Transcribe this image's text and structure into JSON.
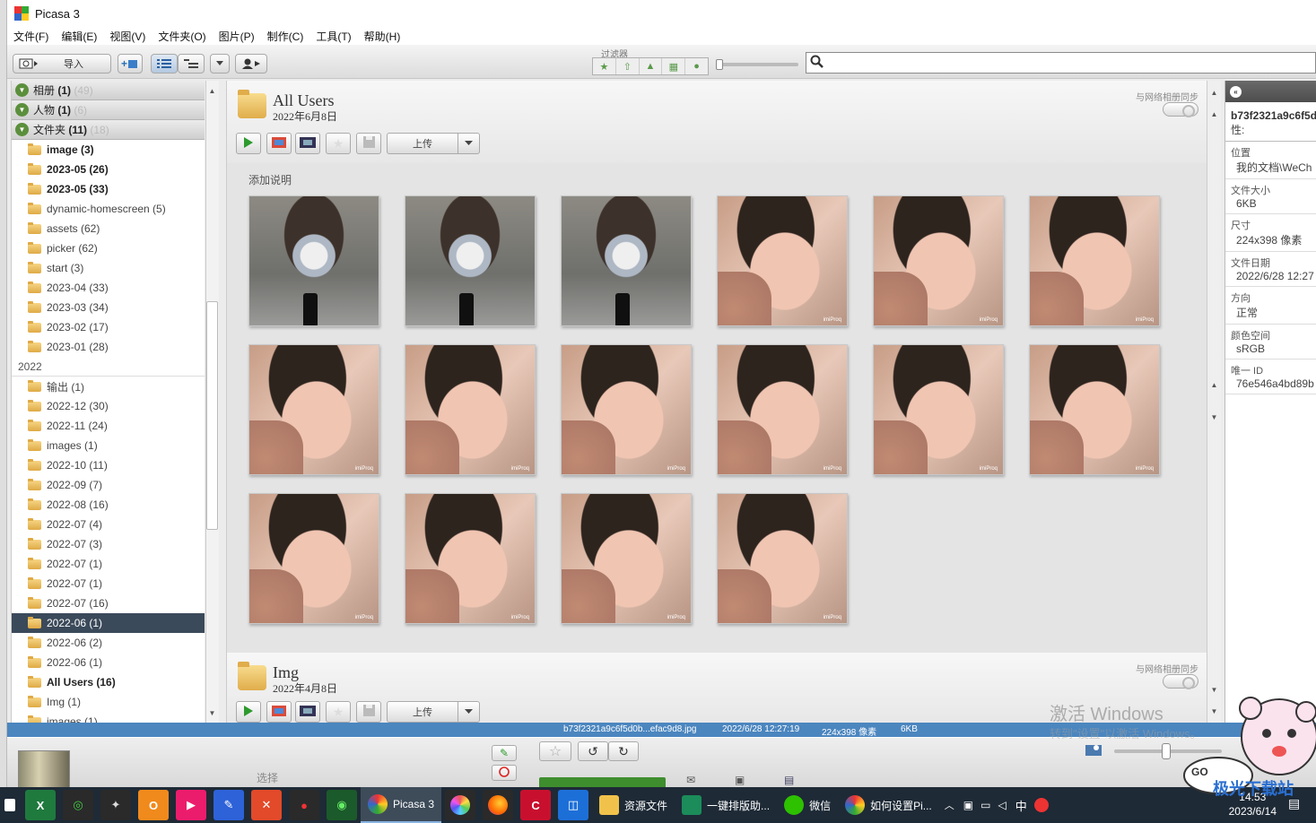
{
  "app": {
    "title": "Picasa 3"
  },
  "menu": [
    "文件(F)",
    "编辑(E)",
    "视图(V)",
    "文件夹(O)",
    "图片(P)",
    "制作(C)",
    "工具(T)",
    "帮助(H)"
  ],
  "toolbar": {
    "import_label": "导入",
    "filter_label": "过滤器",
    "search_value": ""
  },
  "sidebar": {
    "sections": [
      {
        "label": "相册",
        "count": "(1)",
        "ghost": "(49)"
      },
      {
        "label": "人物",
        "count": "(1)",
        "ghost": "(6)"
      },
      {
        "label": "文件夹",
        "count": "(11)",
        "ghost": "(18)"
      }
    ],
    "folders_a": [
      {
        "label": "image (3)",
        "bold": true
      },
      {
        "label": "2023-05 (26)",
        "bold": true
      },
      {
        "label": "2023-05 (33)",
        "bold": true
      },
      {
        "label": "dynamic-homescreen (5)",
        "bold": false
      },
      {
        "label": "assets (62)",
        "bold": false
      },
      {
        "label": "picker (62)",
        "bold": false
      },
      {
        "label": "start (3)",
        "bold": false
      },
      {
        "label": "2023-04 (33)",
        "bold": false
      },
      {
        "label": "2023-03 (34)",
        "bold": false
      },
      {
        "label": "2023-02 (17)",
        "bold": false
      },
      {
        "label": "2023-01 (28)",
        "bold": false
      }
    ],
    "year": "2022",
    "folders_b": [
      {
        "label": "输出 (1)",
        "bold": false
      },
      {
        "label": "2022-12 (30)",
        "bold": false
      },
      {
        "label": "2022-11 (24)",
        "bold": false
      },
      {
        "label": "images (1)",
        "bold": false
      },
      {
        "label": "2022-10 (11)",
        "bold": false
      },
      {
        "label": "2022-09 (7)",
        "bold": false
      },
      {
        "label": "2022-08 (16)",
        "bold": false
      },
      {
        "label": "2022-07 (4)",
        "bold": false
      },
      {
        "label": "2022-07 (3)",
        "bold": false
      },
      {
        "label": "2022-07 (1)",
        "bold": false
      },
      {
        "label": "2022-07 (1)",
        "bold": false
      },
      {
        "label": "2022-07 (16)",
        "bold": false
      },
      {
        "label": "2022-06 (1)",
        "bold": false,
        "selected": true
      },
      {
        "label": "2022-06 (2)",
        "bold": false
      },
      {
        "label": "2022-06 (1)",
        "bold": false
      },
      {
        "label": "All Users (16)",
        "bold": true
      },
      {
        "label": "Img (1)",
        "bold": false
      },
      {
        "label": "images (1)",
        "bold": false
      }
    ]
  },
  "albums": [
    {
      "title": "All Users",
      "date": "2022年6月8日",
      "sync_label": "与网络相册同步",
      "upload_label": "上传",
      "caption": "添加说明",
      "photos": [
        "kid",
        "kid",
        "kid",
        "baby",
        "baby",
        "baby",
        "baby",
        "baby",
        "baby",
        "baby",
        "baby",
        "baby",
        "baby",
        "baby",
        "baby",
        "baby"
      ]
    },
    {
      "title": "Img",
      "date": "2022年4月8日",
      "sync_label": "与网络相册同步",
      "upload_label": "上传"
    }
  ],
  "photo_watermark": "imiProq",
  "props": {
    "header_id": "b73f2321a9c6f5d",
    "header_sub": "性:",
    "rows": [
      {
        "label": "位置",
        "value": "我的文档\\WeCh"
      },
      {
        "label": "文件大小",
        "value": "6KB"
      },
      {
        "label": "尺寸",
        "value": "224x398 像素"
      },
      {
        "label": "文件日期",
        "value": "2022/6/28 12:27"
      },
      {
        "label": "方向",
        "value": "正常"
      },
      {
        "label": "颜色空间",
        "value": "sRGB"
      },
      {
        "label": "唯一 ID",
        "value": "76e546a4bd89b"
      }
    ]
  },
  "status": {
    "filename": "b73f2321a9c6f5d0b...efac9d8.jpg",
    "datetime": "2022/6/28 12:27:19",
    "dims": "224x398 像素",
    "size": "6KB"
  },
  "bottom": {
    "select_label": "选择"
  },
  "watermark": {
    "line1": "激活 Windows",
    "line2": "转到\"设置\"以激活 Windows。"
  },
  "taskbar": {
    "apps": [
      {
        "label": "Picasa 3",
        "active": true
      },
      {
        "label": "资源文件"
      },
      {
        "label": "一键排版助..."
      },
      {
        "label": "微信"
      },
      {
        "label": "如何设置Pi..."
      }
    ],
    "ime": "中",
    "time": "14:53",
    "date": "2023/6/14"
  },
  "sticker_text": "极光下载站"
}
